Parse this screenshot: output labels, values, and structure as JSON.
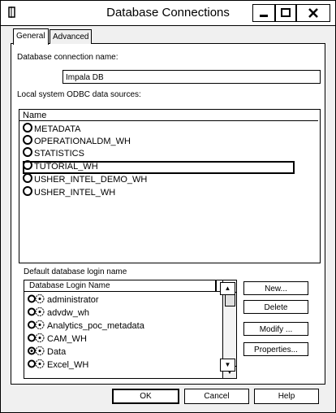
{
  "window": {
    "title": "Database Connections",
    "minimize_label": "▁",
    "maximize_label": "□",
    "close_label": "✕"
  },
  "tabs": [
    {
      "label": "General",
      "active": true
    },
    {
      "label": "Advanced",
      "active": false
    }
  ],
  "connection_name": {
    "label": "Database connection name:",
    "value": "Impala DB"
  },
  "dsn": {
    "label": "Local system ODBC data sources:",
    "column_header": "Name",
    "items": [
      {
        "label": "METADATA"
      },
      {
        "label": "OPERATIONALDM_WH"
      },
      {
        "label": "STATISTICS"
      },
      {
        "label": "TUTORIAL_WH",
        "selected": true
      },
      {
        "label": "USHER_INTEL_DEMO_WH"
      },
      {
        "label": "USHER_INTEL_WH"
      }
    ]
  },
  "login": {
    "label": "Default database login name",
    "column_header": "Database Login Name",
    "items": [
      {
        "label": "administrator"
      },
      {
        "label": "advdw_wh"
      },
      {
        "label": "Analytics_poc_metadata"
      },
      {
        "label": "CAM_WH"
      },
      {
        "label": "Data"
      },
      {
        "label": "Excel_WH"
      }
    ]
  },
  "side_buttons": {
    "new": "New...",
    "delete": "Delete",
    "modify": "Modify ...",
    "properties": "Properties..."
  },
  "footer": {
    "ok": "OK",
    "cancel": "Cancel",
    "help": "Help"
  }
}
